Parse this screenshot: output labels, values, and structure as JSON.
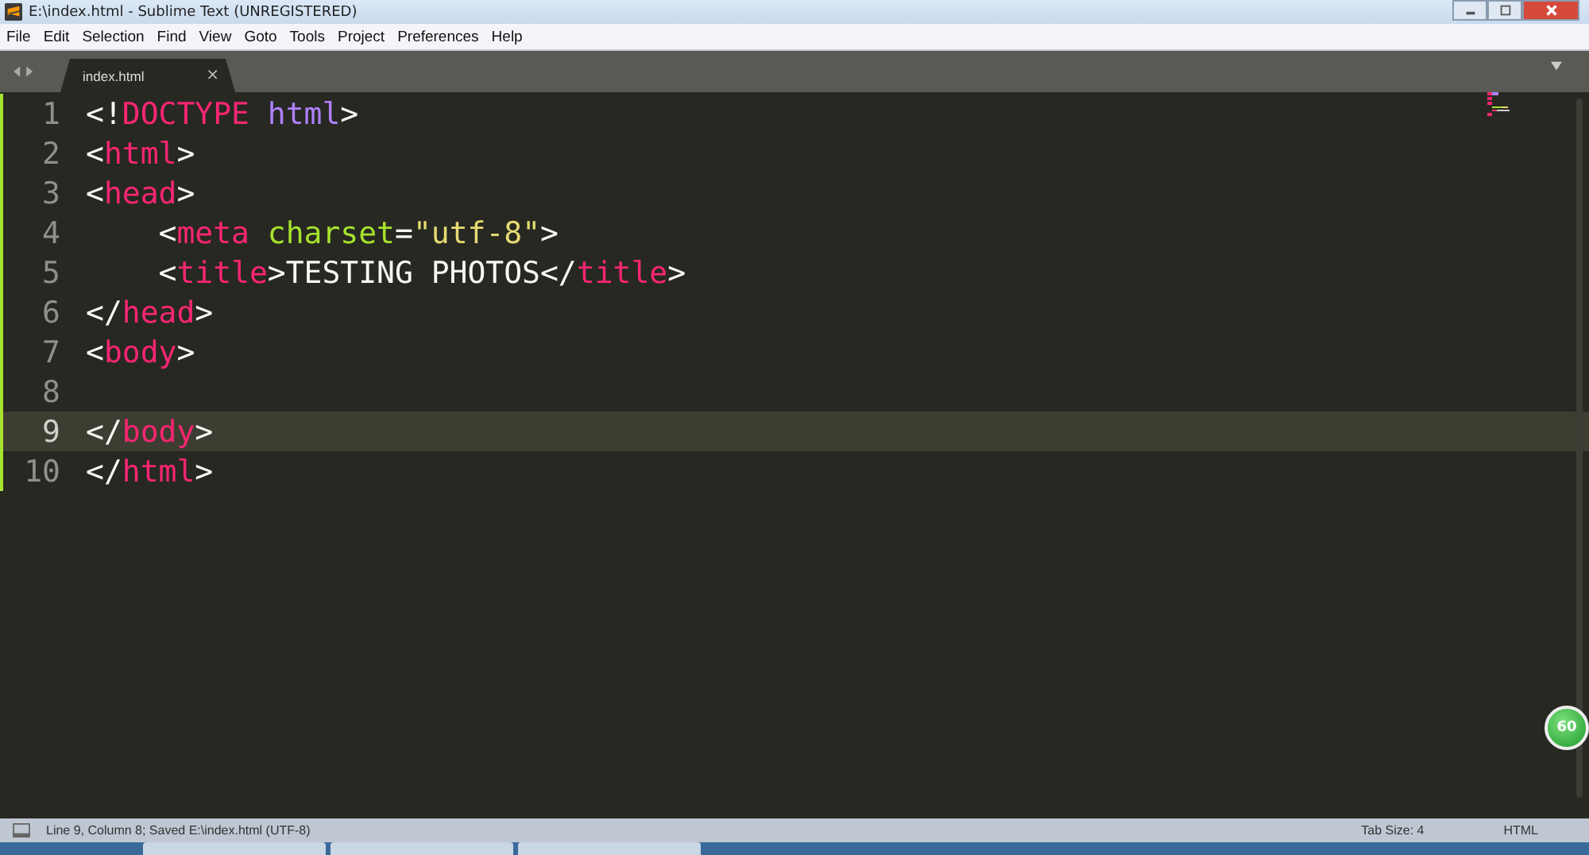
{
  "window": {
    "title": "E:\\index.html - Sublime Text (UNREGISTERED)"
  },
  "menu": [
    "File",
    "Edit",
    "Selection",
    "Find",
    "View",
    "Goto",
    "Tools",
    "Project",
    "Preferences",
    "Help"
  ],
  "tabs": [
    {
      "label": "index.html",
      "selected": true,
      "close": "×"
    }
  ],
  "editor": {
    "lines": [
      {
        "number": "1",
        "current": false,
        "modified": true,
        "tokens": [
          {
            "kind": "punct",
            "text": "<!"
          },
          {
            "kind": "tag",
            "text": "DOCTYPE"
          },
          {
            "kind": "keyword",
            "text": " html"
          },
          {
            "kind": "punct",
            "text": ">"
          }
        ]
      },
      {
        "number": "2",
        "current": false,
        "modified": true,
        "tokens": [
          {
            "kind": "punct",
            "text": "<"
          },
          {
            "kind": "tag",
            "text": "html"
          },
          {
            "kind": "punct",
            "text": ">"
          }
        ]
      },
      {
        "number": "3",
        "current": false,
        "modified": true,
        "tokens": [
          {
            "kind": "punct",
            "text": "<"
          },
          {
            "kind": "tag",
            "text": "head"
          },
          {
            "kind": "punct",
            "text": ">"
          }
        ]
      },
      {
        "number": "4",
        "current": false,
        "modified": true,
        "tokens": [
          {
            "kind": "punct",
            "text": "    <"
          },
          {
            "kind": "tag",
            "text": "meta"
          },
          {
            "kind": "attr",
            "text": " charset"
          },
          {
            "kind": "punct",
            "text": "="
          },
          {
            "kind": "string",
            "text": "\"utf-8\""
          },
          {
            "kind": "punct",
            "text": ">"
          }
        ]
      },
      {
        "number": "5",
        "current": false,
        "modified": true,
        "tokens": [
          {
            "kind": "punct",
            "text": "    <"
          },
          {
            "kind": "tag",
            "text": "title"
          },
          {
            "kind": "punct",
            "text": ">TESTING PHOTOS</"
          },
          {
            "kind": "tag",
            "text": "title"
          },
          {
            "kind": "punct",
            "text": ">"
          }
        ]
      },
      {
        "number": "6",
        "current": false,
        "modified": true,
        "tokens": [
          {
            "kind": "punct",
            "text": "</"
          },
          {
            "kind": "tag",
            "text": "head"
          },
          {
            "kind": "punct",
            "text": ">"
          }
        ]
      },
      {
        "number": "7",
        "current": false,
        "modified": true,
        "tokens": [
          {
            "kind": "punct",
            "text": "<"
          },
          {
            "kind": "tag",
            "text": "body"
          },
          {
            "kind": "punct",
            "text": ">"
          }
        ]
      },
      {
        "number": "8",
        "current": false,
        "modified": true
      },
      {
        "number": "9",
        "current": true,
        "modified": true,
        "tokens": [
          {
            "kind": "punct",
            "text": "</"
          },
          {
            "kind": "tag",
            "text": "body"
          },
          {
            "kind": "punct",
            "text": ">"
          }
        ]
      },
      {
        "number": "10",
        "current": false,
        "modified": true,
        "tokens": [
          {
            "kind": "punct",
            "text": "</"
          },
          {
            "kind": "tag",
            "text": "html"
          },
          {
            "kind": "punct",
            "text": ">"
          }
        ]
      }
    ]
  },
  "status_bar": {
    "message": "Line 9, Column 8; Saved E:\\index.html (UTF-8)",
    "tab_size": "Tab Size: 4",
    "syntax": "HTML"
  },
  "overlay_badge": {
    "text": "60"
  }
}
